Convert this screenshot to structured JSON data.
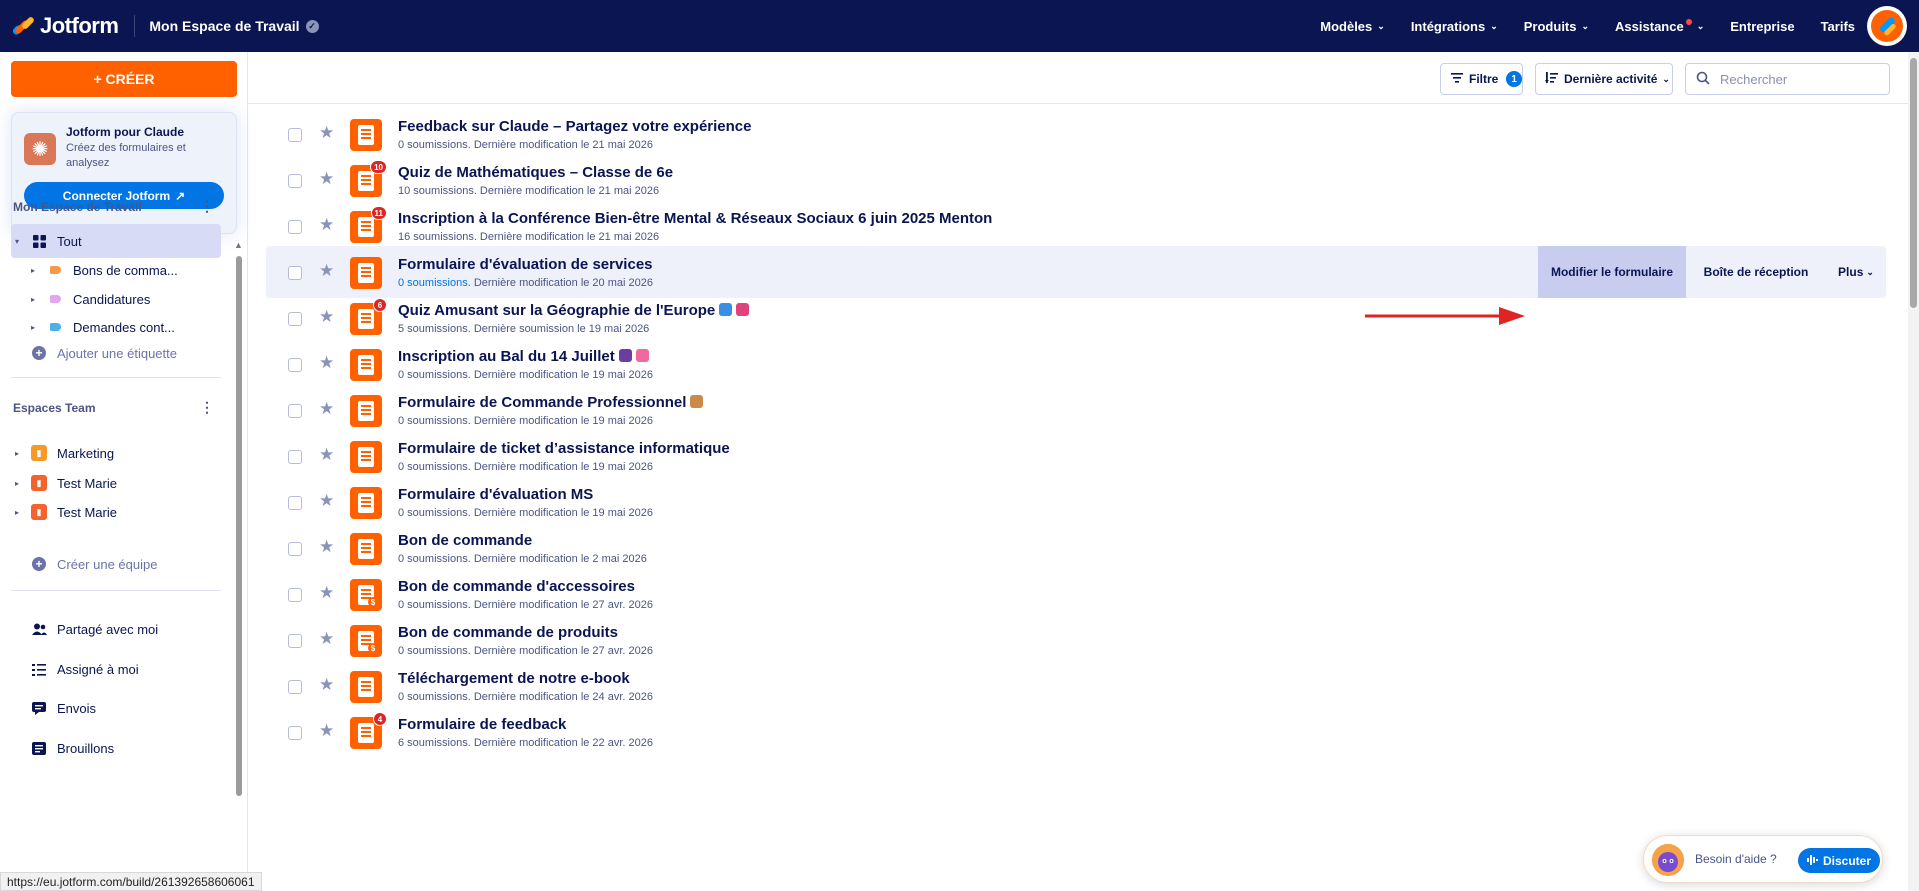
{
  "header": {
    "brand": "Jotform",
    "workspace": "Mon Espace de Travail",
    "nav": [
      {
        "label": "Modèles",
        "dropdown": true
      },
      {
        "label": "Intégrations",
        "dropdown": true
      },
      {
        "label": "Produits",
        "dropdown": true
      },
      {
        "label": "Assistance",
        "dropdown": true,
        "notification": true
      },
      {
        "label": "Entreprise",
        "dropdown": false
      },
      {
        "label": "Tarifs",
        "dropdown": false
      }
    ]
  },
  "sidebar": {
    "create_label": "+ CRÉER",
    "promo": {
      "title": "Jotform pour Claude",
      "description": "Créez des formulaires et analysez",
      "button": "Connecter Jotform"
    },
    "workspace_heading": "Mon Espace de Travail",
    "workspace_items": [
      {
        "label": "Tout",
        "icon": "grid-icon",
        "active": true
      },
      {
        "label": "Bons de comma...",
        "icon": "label-icon",
        "color": "#f59a45"
      },
      {
        "label": "Candidatures",
        "icon": "label-icon",
        "color": "#e3a7f0"
      },
      {
        "label": "Demandes cont...",
        "icon": "label-icon",
        "color": "#4ab2e8"
      }
    ],
    "add_label": "Ajouter une étiquette",
    "teams_heading": "Espaces Team",
    "teams": [
      {
        "label": "Marketing",
        "color": "#f59a2a"
      },
      {
        "label": "Test Marie",
        "color": "#f4622d"
      },
      {
        "label": "Test Marie",
        "color": "#f4622d"
      }
    ],
    "create_team": "Créer une équipe",
    "links": [
      {
        "label": "Partagé avec moi",
        "icon": "people-icon"
      },
      {
        "label": "Assigné à moi",
        "icon": "checklist-icon"
      },
      {
        "label": "Envois",
        "icon": "message-icon"
      },
      {
        "label": "Brouillons",
        "icon": "draft-icon"
      }
    ]
  },
  "toolbar": {
    "filter_label": "Filtre",
    "filter_count": "1",
    "sort_label": "Dernière activité",
    "search_placeholder": "Rechercher"
  },
  "forms": [
    {
      "title": "Feedback sur Claude – Partagez votre expérience",
      "subs": "0 soumissions.",
      "meta": " Dernière modification le 21 mai 2026",
      "badge": ""
    },
    {
      "title": "Quiz de Mathématiques – Classe de 6e",
      "subs": "10 soumissions.",
      "meta": " Dernière modification le 21 mai 2026",
      "badge": "10"
    },
    {
      "title": "Inscription à la Conférence Bien-être Mental & Réseaux Sociaux 6 juin 2025 Menton",
      "subs": "16 soumissions.",
      "meta": " Dernière modification le 21 mai 2026",
      "badge": "11"
    },
    {
      "title": "Formulaire d'évaluation de services",
      "subs": "0 soumissions.",
      "meta": " Dernière modification le 20 mai 2026",
      "badge": "",
      "hover": true
    },
    {
      "title": "Quiz Amusant sur la Géographie de l'Europe",
      "subs": "5 soumissions.",
      "meta": " Dernière soumission le 19 mai 2026",
      "badge": "6",
      "emoji": [
        "#3a8ee6",
        "#e0427a"
      ]
    },
    {
      "title": "Inscription au Bal du 14 Juillet",
      "subs": "0 soumissions.",
      "meta": " Dernière modification le 19 mai 2026",
      "badge": "",
      "emoji": [
        "#6b3fa0",
        "#f06aa0"
      ]
    },
    {
      "title": "Formulaire de Commande Professionnel",
      "subs": "0 soumissions.",
      "meta": " Dernière modification le 19 mai 2026",
      "badge": "",
      "emoji": [
        "#c98a4a"
      ]
    },
    {
      "title": "Formulaire de ticket d’assistance informatique",
      "subs": "0 soumissions.",
      "meta": " Dernière modification le 19 mai 2026",
      "badge": ""
    },
    {
      "title": "Formulaire d'évaluation MS",
      "subs": "0 soumissions.",
      "meta": " Dernière modification le 19 mai 2026",
      "badge": ""
    },
    {
      "title": "Bon de commande",
      "subs": "0 soumissions.",
      "meta": " Dernière modification le 2 mai 2026",
      "badge": ""
    },
    {
      "title": "Bon de commande d'accessoires",
      "subs": "0 soumissions.",
      "meta": " Dernière modification le 27 avr. 2026",
      "badge": "",
      "payment": true
    },
    {
      "title": "Bon de commande de produits",
      "subs": "0 soumissions.",
      "meta": " Dernière modification le 27 avr. 2026",
      "badge": "",
      "payment": true
    },
    {
      "title": "Téléchargement de notre e-book",
      "subs": "0 soumissions.",
      "meta": " Dernière modification le 24 avr. 2026",
      "badge": ""
    },
    {
      "title": "Formulaire de feedback",
      "subs": "6 soumissions.",
      "meta": " Dernière modification le 22 avr. 2026",
      "badge": "4"
    }
  ],
  "row_actions": {
    "edit": "Modifier le formulaire",
    "inbox": "Boîte de réception",
    "more": "Plus"
  },
  "status_url": "https://eu.jotform.com/build/261392658606061",
  "help": {
    "text": "Besoin d'aide ?",
    "button": "Discuter"
  },
  "colors": {
    "navy": "#0a1551",
    "orange": "#ff6100",
    "blue": "#0075e3",
    "arrow": "#e02424"
  }
}
